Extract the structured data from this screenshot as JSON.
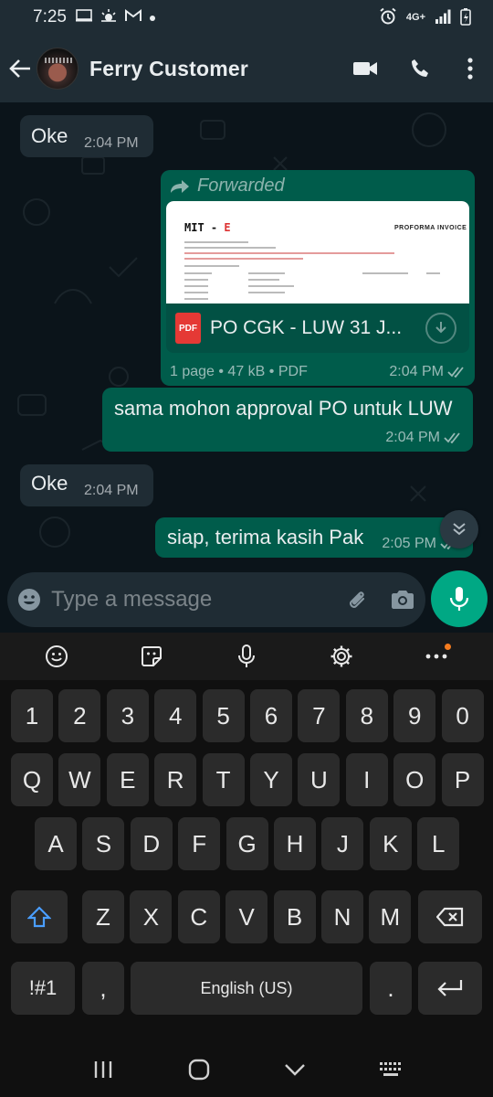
{
  "status_bar": {
    "time": "7:25",
    "network": "4G+"
  },
  "header": {
    "contact_name": "Ferry Customer"
  },
  "messages": [
    {
      "direction": "incoming",
      "text": "Oke",
      "time": "2:04 PM"
    },
    {
      "direction": "outgoing",
      "forwarded_label": "Forwarded",
      "document": {
        "preview_brand": "MIT - ",
        "preview_brand_accent": "E",
        "preview_heading": "PROFORMA INVOICE",
        "file_type": "PDF",
        "file_name": "PO CGK - LUW 31 J...",
        "info": "1 page • 47 kB • PDF"
      },
      "time": "2:04 PM",
      "status": "read"
    },
    {
      "direction": "outgoing",
      "text": "sama mohon approval PO untuk LUW",
      "time": "2:04 PM",
      "status": "read"
    },
    {
      "direction": "incoming",
      "text": "Oke",
      "time": "2:04 PM"
    },
    {
      "direction": "outgoing",
      "text": "siap, terima kasih Pak",
      "time": "2:05 PM",
      "status": "read"
    }
  ],
  "composer": {
    "placeholder": "Type a message"
  },
  "keyboard": {
    "rows": [
      [
        "1",
        "2",
        "3",
        "4",
        "5",
        "6",
        "7",
        "8",
        "9",
        "0"
      ],
      [
        "Q",
        "W",
        "E",
        "R",
        "T",
        "Y",
        "U",
        "I",
        "O",
        "P"
      ],
      [
        "A",
        "S",
        "D",
        "F",
        "G",
        "H",
        "J",
        "K",
        "L"
      ],
      [
        "Z",
        "X",
        "C",
        "V",
        "B",
        "N",
        "M"
      ]
    ],
    "symbols_label": "!#1",
    "comma_label": ",",
    "space_label": "English (US)",
    "period_label": "."
  },
  "colors": {
    "header_bg": "#1f2c34",
    "chat_bg": "#0b141a",
    "incoming_bubble": "#1f2c34",
    "outgoing_bubble": "#005c4b",
    "accent_green": "#00a884",
    "read_tick": "#53bdeb"
  }
}
